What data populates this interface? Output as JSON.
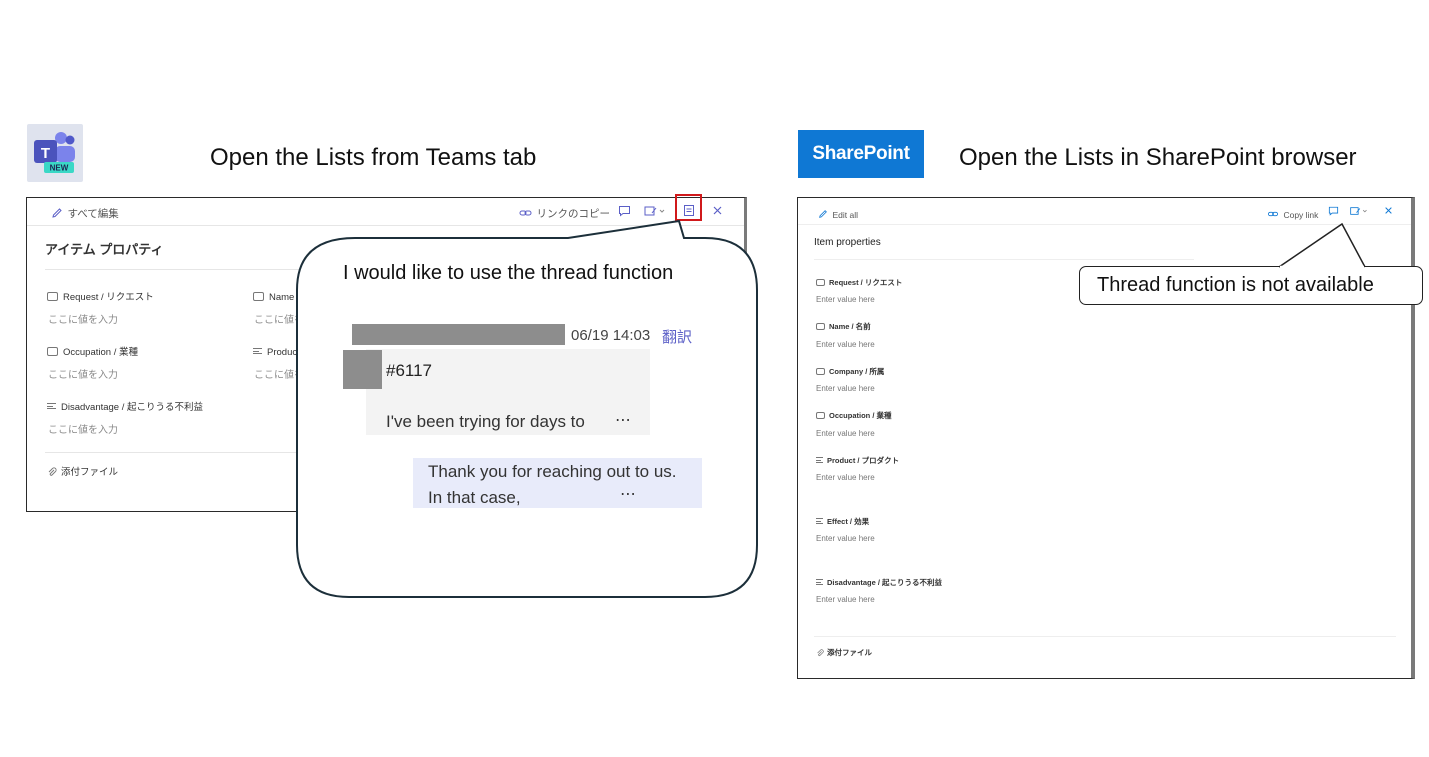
{
  "left": {
    "heading": "Open the Lists from Teams tab",
    "logo_badge": "NEW",
    "toolbar": {
      "edit_all": "すべて編集",
      "copy_link": "リンクのコピー"
    },
    "panel_title": "アイテム プロパティ",
    "fields": [
      {
        "label": "Request / リクエスト",
        "value": "ここに値を入力"
      },
      {
        "label": "Name / 名前",
        "value": "ここに値を入力"
      },
      {
        "label": "Occupation / 業種",
        "value": "ここに値を入力"
      },
      {
        "label": "Product / プロダクト",
        "value": "ここに値を入力"
      },
      {
        "label": "Disadvantage / 起こりうる不利益",
        "value": "ここに値を入力"
      }
    ],
    "attachments": "添付ファイル",
    "callout": "I would like to use the thread function",
    "message": {
      "time": "06/19 14:03",
      "translate": "翻訳",
      "id": "#6117",
      "body": "I've been trying for days to",
      "more": "⋯",
      "reply": "Thank you for reaching out to us. In that case,",
      "reply_more": "⋯"
    }
  },
  "right": {
    "heading": "Open the Lists in SharePoint browser",
    "logo": "SharePoint",
    "toolbar": {
      "edit_all": "Edit all",
      "copy_link": "Copy link"
    },
    "panel_title": "Item properties",
    "fields": [
      {
        "label": "Request / リクエスト",
        "value": "Enter value here"
      },
      {
        "label": "Name / 名前",
        "value": "Enter value here"
      },
      {
        "label": "Company / 所属",
        "value": "Enter value here"
      },
      {
        "label": "Occupation / 業種",
        "value": "Enter value here"
      },
      {
        "label": "Product / プロダクト",
        "value": "Enter value here"
      },
      {
        "label": "Effect / 効果",
        "value": "Enter value here"
      },
      {
        "label": "Disadvantage / 起こりうる不利益",
        "value": "Enter value here"
      }
    ],
    "attachments": "添付ファイル",
    "callout": "Thread function is not available"
  },
  "colors": {
    "teams_purple": "#5b5fc7",
    "sharepoint_blue": "#0f78d4",
    "highlight_red": "#d0191b",
    "reply_bg": "#e8ebfa"
  }
}
